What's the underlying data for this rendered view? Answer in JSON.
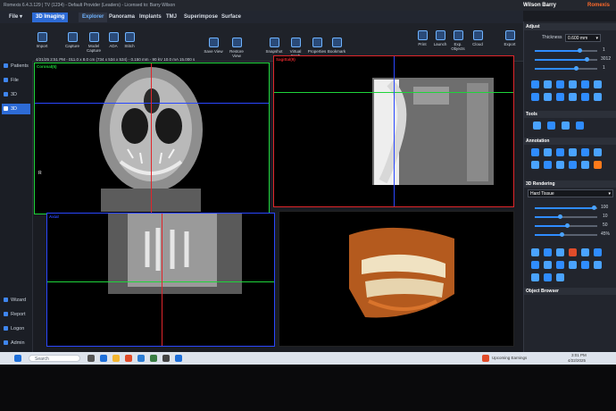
{
  "window": {
    "title": "Romexis 6.4.3.129 | TV (1234) - Default Provider (Leaders) - Licensed to: Barry Wilson",
    "user": "Wilson Barry",
    "brand": "Romexis"
  },
  "ribbon": {
    "tabs": [
      "File ▾",
      "3D Imaging",
      "Explorer",
      "Panorama",
      "Implants",
      "TMJ",
      "Superimpose",
      "Surface"
    ],
    "tools_left": [
      "Import",
      "Capture",
      "Model Capture",
      "ADA",
      "Stitch"
    ],
    "tools_mid": [
      "Save View",
      "Restore View"
    ],
    "tools_center": [
      "Snapshot",
      "Virtual Ceph",
      "Properties",
      "Bookmark"
    ],
    "tools_right": [
      "Print",
      "Launch",
      "Exp. Objects",
      "Cloud",
      "Export"
    ]
  },
  "nav": {
    "items": [
      "Patients",
      "File",
      "3D",
      "3D"
    ],
    "bottom": [
      "Wizard",
      "Report",
      "Logon",
      "Admin"
    ]
  },
  "status": {
    "text": "4/21/25 2:51 PM - 011.0 x 8.0 cm (734 x 534 x 534) - 0.150 mm - 90 kV 10.0 mA 15.000 s"
  },
  "viewports": {
    "coronal": "Coronal(5)",
    "sagittal": "Sagittal(9)",
    "axial": "Axial",
    "corner": "R"
  },
  "panel": {
    "adjust": "Adjust",
    "thickness_label": "Thickness",
    "thickness_value": "0.600 mm",
    "value_a": "1",
    "value_b": "3012",
    "value_c": "1",
    "tools": "Tools",
    "annotation": "Annotation",
    "rendering": "3D Rendering",
    "preset": "Hard Tissue",
    "pct_a": "100",
    "pct_b": "10",
    "pct_c": "50",
    "pct_d": "45%",
    "object_browser": "Object Browser"
  },
  "colors": {
    "coronal": "#1ed43a",
    "sagittal": "#e0262b",
    "axial": "#2a47ff",
    "accent": "#2d6bd6"
  },
  "taskbar": {
    "search": "Search",
    "notice": "Upcoming Earnings",
    "time": "3:01 PM",
    "date": "4/22/2025"
  }
}
